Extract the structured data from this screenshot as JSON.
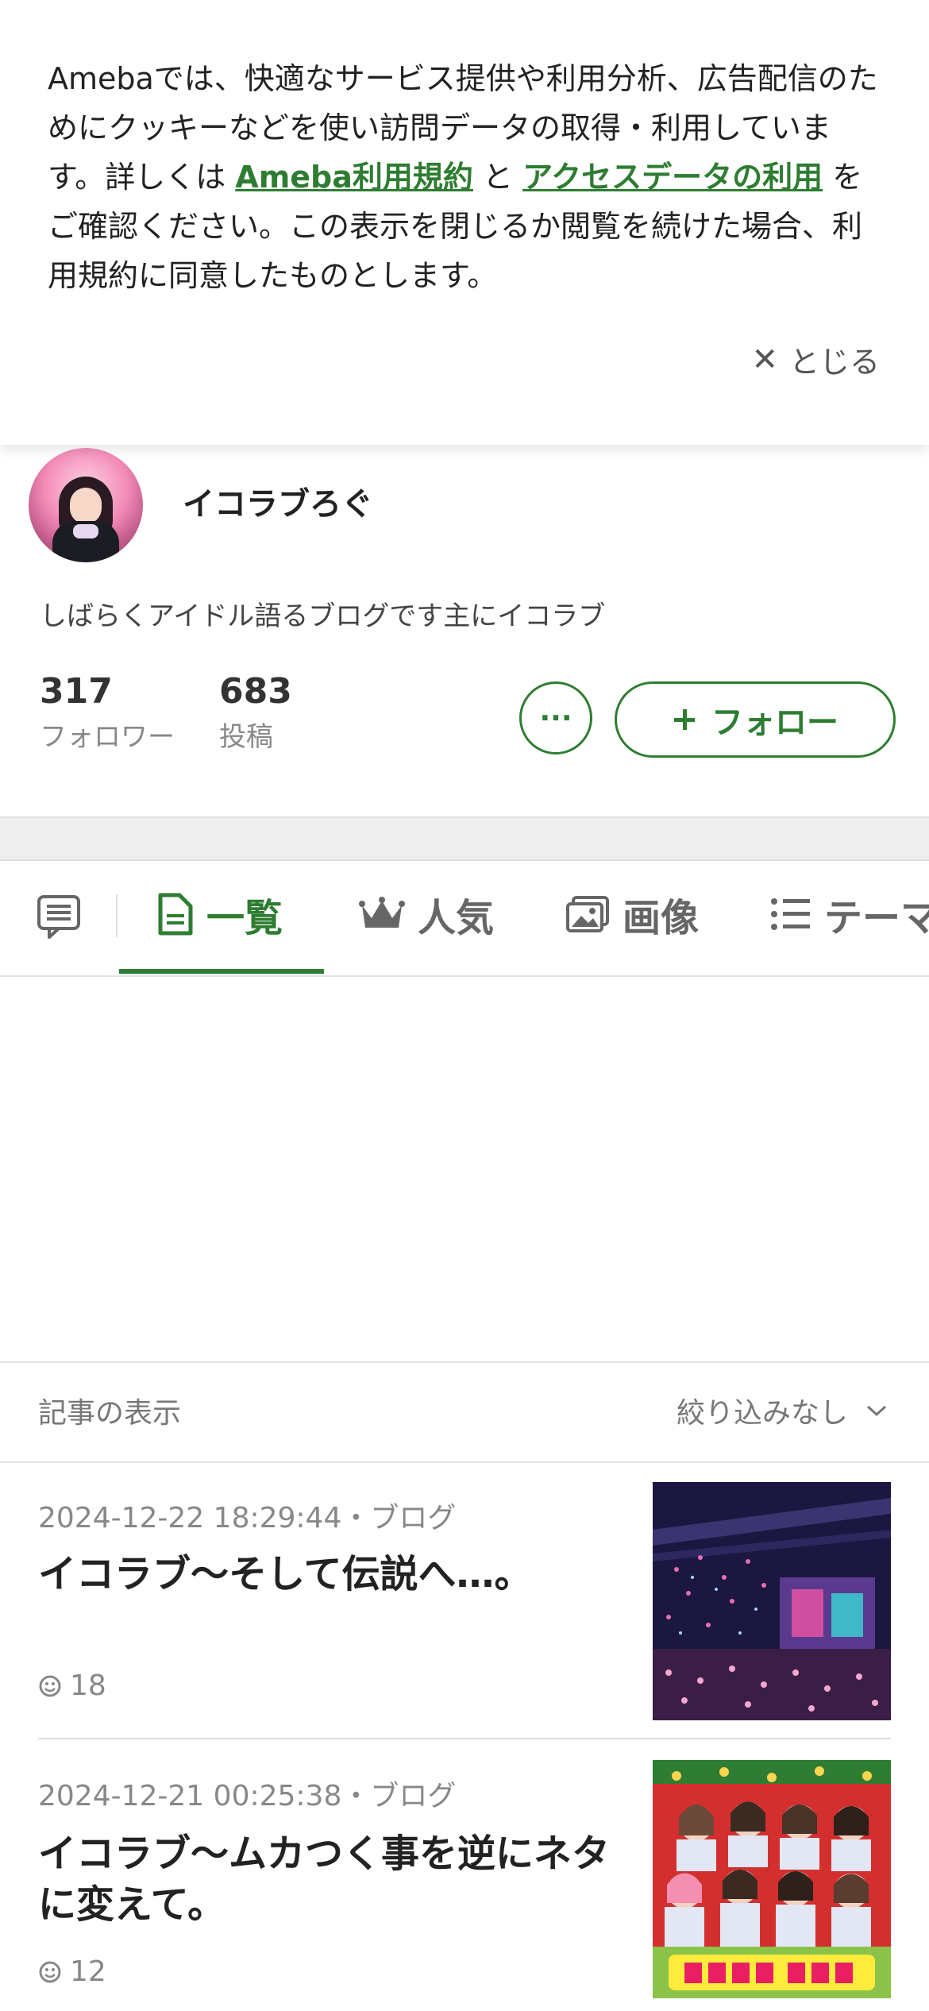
{
  "cookie_banner": {
    "text_before_link1": "Amebaでは、快適なサービス提供や利用分析、広告配信のためにクッキーなどを使い訪問データの取得・利用しています。詳しくは ",
    "link1": "Ameba利用規約",
    "text_between": " と ",
    "link2": "アクセスデータの利用",
    "text_after": " をご確認ください。この表示を閉じるか閲覧を続けた場合、利用規約に同意したものとします。",
    "close_label": "とじる"
  },
  "profile": {
    "blog_title": "イコラブろぐ",
    "description": "しばらくアイドル語るブログです主にイコラブ",
    "followers_count": "317",
    "followers_label": "フォロワー",
    "posts_count": "683",
    "posts_label": "投稿",
    "more_label": "···",
    "follow_label": "フォロー"
  },
  "tabs": [
    {
      "label": "一覧",
      "active": true
    },
    {
      "label": "人気",
      "active": false
    },
    {
      "label": "画像",
      "active": false
    },
    {
      "label": "テーマ",
      "active": false
    }
  ],
  "filter": {
    "label": "記事の表示",
    "value": "絞り込みなし"
  },
  "articles": [
    {
      "meta": "2024-12-22 18:29:44・ブログ",
      "title": "イコラブ〜そして伝説へ…。",
      "likes": "18"
    },
    {
      "meta": "2024-12-21 00:25:38・ブログ",
      "title": "イコラブ〜ムカつく事を逆にネタに変えて。",
      "likes": "12"
    }
  ],
  "colors": {
    "accent": "#2e7d32"
  }
}
